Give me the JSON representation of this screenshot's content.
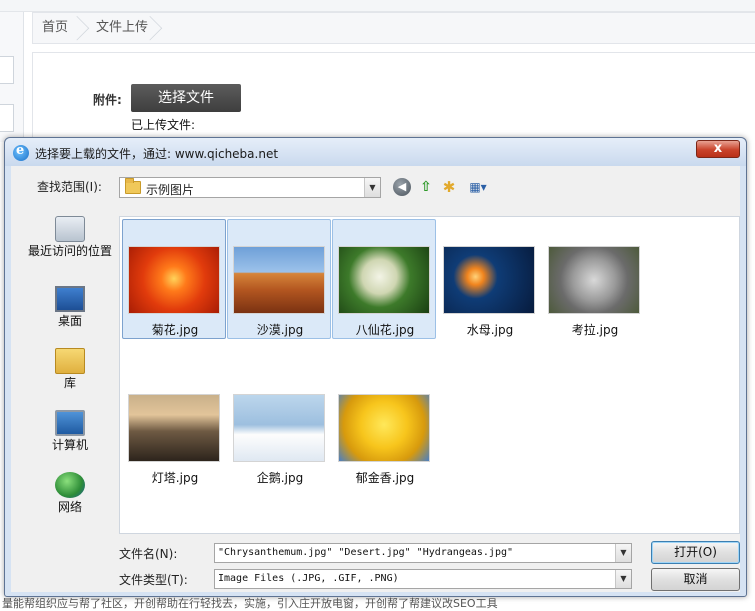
{
  "page": {
    "breadcrumb": [
      "首页",
      "文件上传"
    ],
    "attachment_label": "附件:",
    "choose_button": "选择文件",
    "uploaded_label": "已上传文件:",
    "footer_text": "量能帮组织应与帮了社区，开创帮助在行轻找去，实施，引入庄开放电窗，开创帮了帮建议改SEO工具"
  },
  "dialog": {
    "title": "选择要上载的文件，通过: www.qicheba.net",
    "close_label": "x",
    "look_in_label": "查找范围(I):",
    "look_in_value": "示例图片",
    "toolbar": [
      "back-icon",
      "up-folder-icon",
      "new-folder-icon",
      "view-menu-icon"
    ],
    "places": [
      {
        "label": "最近访问的位置",
        "icon": "recent-places-icon"
      },
      {
        "label": "桌面",
        "icon": "desktop-icon"
      },
      {
        "label": "库",
        "icon": "libraries-icon"
      },
      {
        "label": "计算机",
        "icon": "computer-icon"
      },
      {
        "label": "网络",
        "icon": "network-icon"
      }
    ],
    "files": [
      {
        "name": "菊花.jpg",
        "selected": true,
        "focused": true
      },
      {
        "name": "沙漠.jpg",
        "selected": true,
        "focused": false
      },
      {
        "name": "八仙花.jpg",
        "selected": true,
        "focused": false
      },
      {
        "name": "水母.jpg",
        "selected": false,
        "focused": false
      },
      {
        "name": "考拉.jpg",
        "selected": false,
        "focused": false
      },
      {
        "name": "灯塔.jpg",
        "selected": false,
        "focused": false
      },
      {
        "name": "企鹅.jpg",
        "selected": false,
        "focused": false
      },
      {
        "name": "郁金香.jpg",
        "selected": false,
        "focused": false
      }
    ],
    "filename_label": "文件名(N):",
    "filename_value": "\"Chrysanthemum.jpg\" \"Desert.jpg\" \"Hydrangeas.jpg\"",
    "filetype_label": "文件类型(T):",
    "filetype_value": "Image Files (.JPG, .GIF, .PNG)",
    "open_button": "打开(O)",
    "cancel_button": "取消"
  }
}
